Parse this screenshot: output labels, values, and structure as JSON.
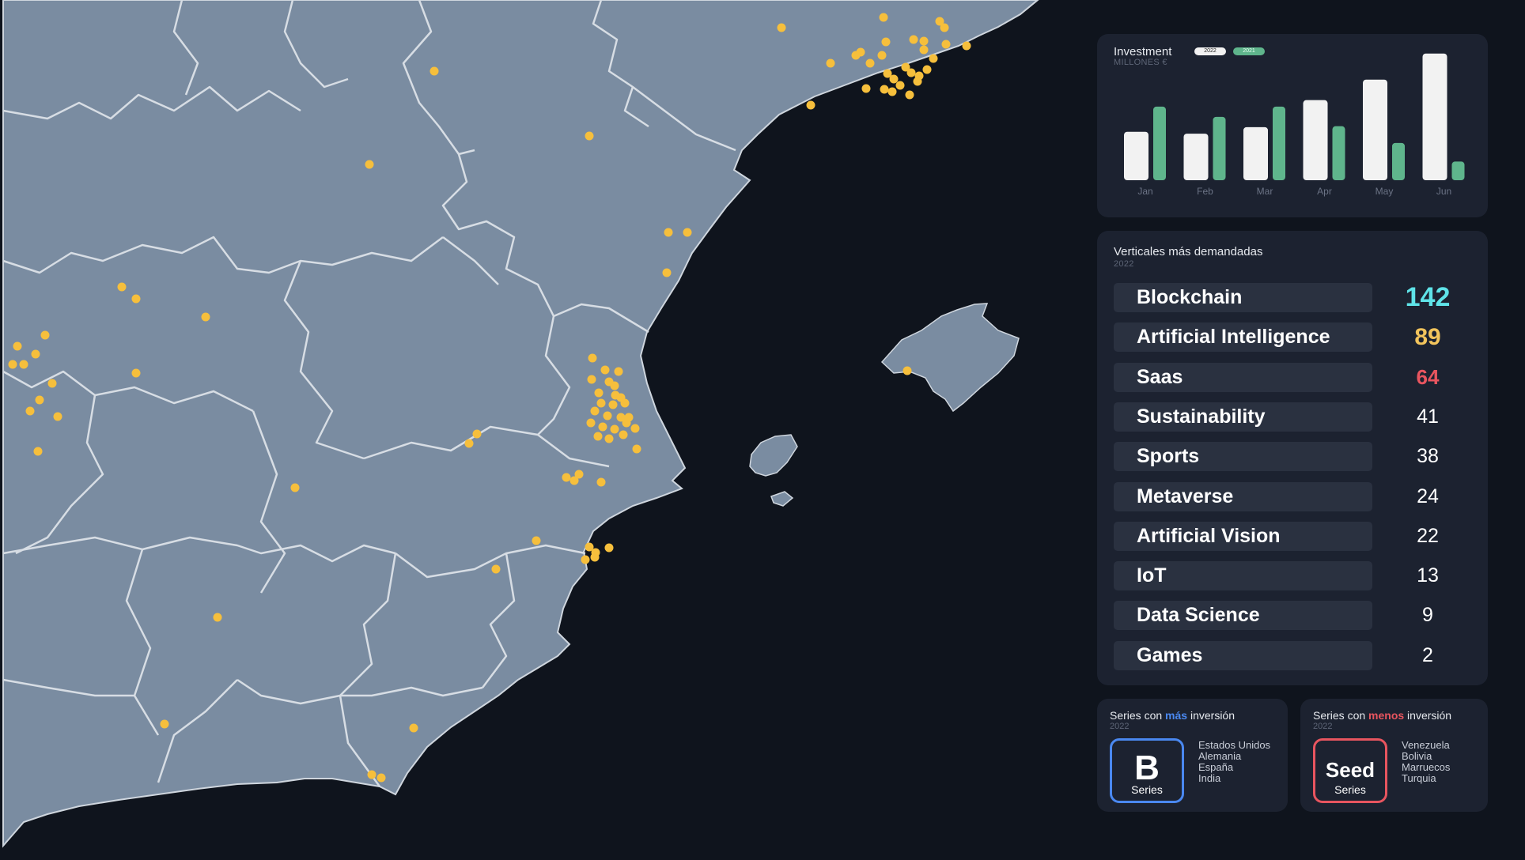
{
  "investment": {
    "title": "Investment",
    "subtitle": "MILLONES €",
    "legend": [
      "2022",
      "2021"
    ],
    "colors": {
      "2022": "#f2f2f2",
      "2021": "#5fb58c"
    }
  },
  "chart_data": {
    "type": "bar",
    "title": "Investment",
    "subtitle": "MILLONES €",
    "categories": [
      "Jan",
      "Feb",
      "Mar",
      "Apr",
      "May",
      "Jun"
    ],
    "series": [
      {
        "name": "2022",
        "values": [
          52,
          50,
          57,
          86,
          108,
          136
        ]
      },
      {
        "name": "2021",
        "values": [
          79,
          68,
          79,
          58,
          40,
          20
        ]
      }
    ],
    "ylim": [
      0,
      140
    ],
    "grid": false,
    "legend_position": "top"
  },
  "verticals": {
    "title": "Verticales más demandadas",
    "subtitle": "2022",
    "items": [
      {
        "label": "Blockchain",
        "value": "142",
        "color": "#5fe3e8",
        "size": 34
      },
      {
        "label": "Artificial Intelligence",
        "value": "89",
        "color": "#f2c45c",
        "size": 30
      },
      {
        "label": "Saas",
        "value": "64",
        "color": "#e8555f",
        "size": 26
      },
      {
        "label": "Sustainability",
        "value": "41",
        "color": "#ffffff",
        "size": 25
      },
      {
        "label": "Sports",
        "value": "38",
        "color": "#ffffff",
        "size": 25
      },
      {
        "label": "Metaverse",
        "value": "24",
        "color": "#ffffff",
        "size": 25
      },
      {
        "label": "Artificial Vision",
        "value": "22",
        "color": "#ffffff",
        "size": 25
      },
      {
        "label": "IoT",
        "value": "13",
        "color": "#ffffff",
        "size": 25
      },
      {
        "label": "Data Science",
        "value": "9",
        "color": "#ffffff",
        "size": 25
      },
      {
        "label": "Games",
        "value": "2",
        "color": "#ffffff",
        "size": 25
      }
    ]
  },
  "series_more": {
    "title_pre": "Series con ",
    "title_highlight": "más",
    "title_post": " inversión",
    "highlight_color": "#4a88f0",
    "subtitle": "2022",
    "big": "B",
    "small": "Series",
    "countries": [
      "Estados Unidos",
      "Alemania",
      "España",
      "India"
    ]
  },
  "series_less": {
    "title_pre": "Series con ",
    "title_highlight": "menos",
    "title_post": " inversión",
    "highlight_color": "#e8555f",
    "subtitle": "2022",
    "big": "Seed",
    "small": "Series",
    "countries": [
      "Venezuela",
      "Bolivia",
      "Marruecos",
      "Turquia"
    ]
  },
  "map": {
    "land_color": "#7a8ca1",
    "sea_color": "#0f141d",
    "border_color": "#d7dde4",
    "marker_color": "#f6bf3c"
  }
}
